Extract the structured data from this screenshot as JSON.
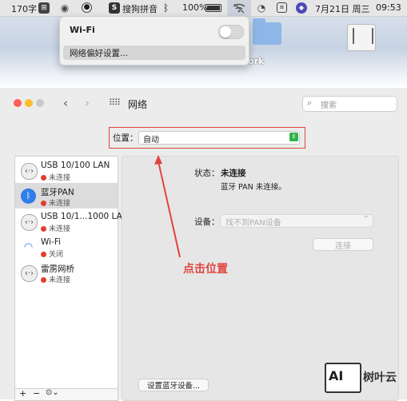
{
  "menubar": {
    "input_method": "170字",
    "sogou_label": "搜狗拼音",
    "battery": "100%",
    "datetime": "7月21日 周三",
    "time": "09:53"
  },
  "desktop": {
    "network_label": "work"
  },
  "wifi_menu": {
    "title": "Wi-Fi",
    "toggle_on": false,
    "preferences_label": "网络偏好设置..."
  },
  "window": {
    "title": "网络",
    "search_placeholder": "搜索",
    "location_label": "位置：",
    "location_value": "自动"
  },
  "services": [
    {
      "name": "USB 10/100 LAN",
      "status": "未连接",
      "status_color": "#e23d2f",
      "icon": "ethernet-icon"
    },
    {
      "name": "蓝牙PAN",
      "status": "未连接",
      "status_color": "#e23d2f",
      "icon": "bluetooth-icon"
    },
    {
      "name": "USB 10/1...1000 LAN",
      "status": "未连接",
      "status_color": "#e23d2f",
      "icon": "ethernet-icon"
    },
    {
      "name": "Wi-Fi",
      "status": "关闭",
      "status_color": "#e23d2f",
      "icon": "wifi-icon"
    },
    {
      "name": "雷雳网桥",
      "status": "未连接",
      "status_color": "#e23d2f",
      "icon": "ethernet-icon"
    }
  ],
  "detail": {
    "status_label": "状态：",
    "status_value": "未连接",
    "status_desc": "蓝牙 PAN 未连接。",
    "device_label": "设备：",
    "device_value": "找不到PAN设备",
    "connect_button": "连接",
    "setup_button": "设置蓝牙设备..."
  },
  "annotation": {
    "text": "点击位置",
    "color": "#e0453d"
  },
  "watermark": {
    "logo": "AI",
    "text": "树叶云"
  }
}
